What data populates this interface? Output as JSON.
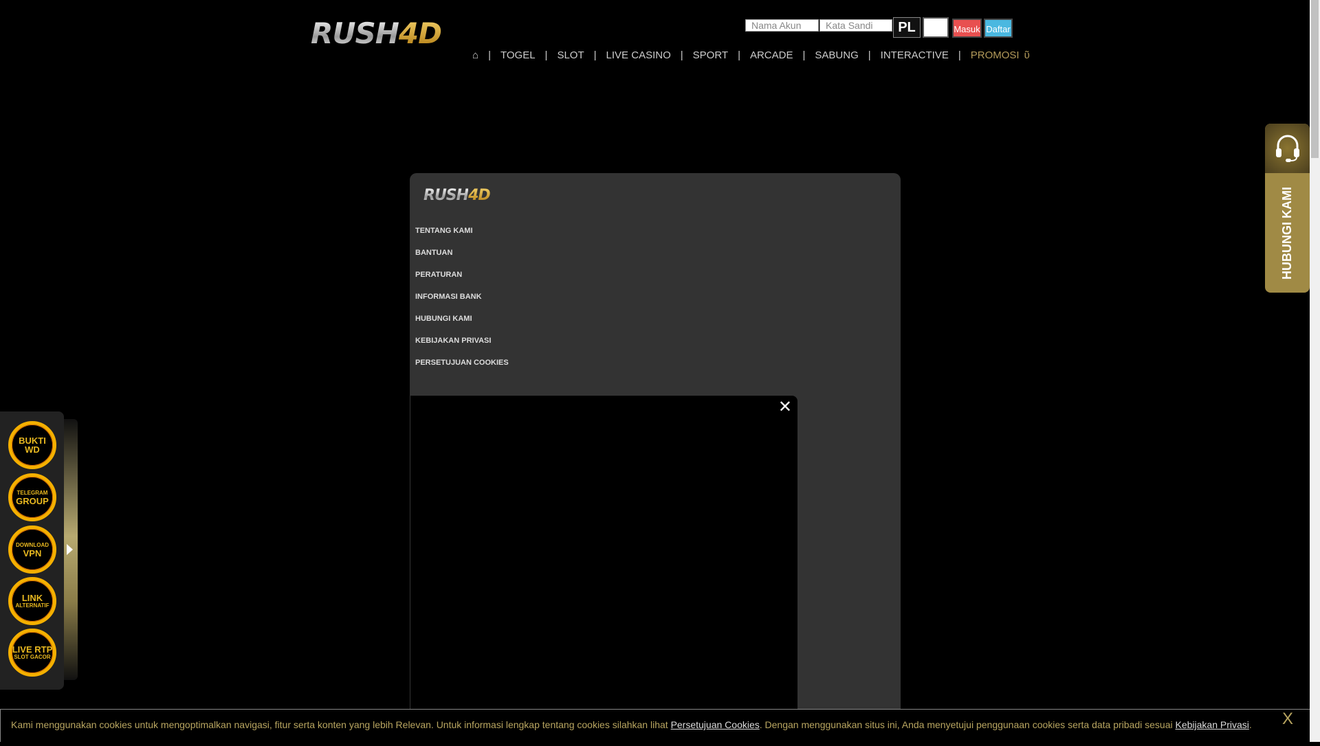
{
  "brand": {
    "logo_a": "RUSH",
    "logo_b": "4D"
  },
  "login": {
    "username_placeholder": "Nama Akun",
    "password_placeholder": "Kata Sandi",
    "captcha": "PL",
    "login_label": "Masuk",
    "register_label": "Daftar"
  },
  "colors": {
    "login": "#e85050",
    "register": "#4ab8e0",
    "gold": "#b39a5a"
  },
  "nav": {
    "home": "⌂",
    "items": [
      "TOGEL",
      "SLOT",
      "LIVE CASINO",
      "SPORT",
      "ARCADE",
      "SABUNG",
      "INTERACTIVE"
    ],
    "promo": "PROMOSI"
  },
  "footer_menu": [
    "TENTANG KAMI",
    "BANTUAN",
    "PERATURAN",
    "INFORMASI BANK",
    "HUBUNGI KAMI",
    "KEBIJAKAN PRIVASI",
    "PERSETUJUAN COOKIES"
  ],
  "side_buttons": [
    {
      "l1": "BUKTI",
      "l2": "WD"
    },
    {
      "l1": "TELEGRAM",
      "l2": "GROUP"
    },
    {
      "l1": "DOWNLOAD",
      "l2": "VPN"
    },
    {
      "l1": "LINK",
      "l2": "ALTERNATIF"
    },
    {
      "l1": "LIVE RTP",
      "l2": "SLOT GACOR"
    }
  ],
  "contact": {
    "label": "HUBUNGI KAMI"
  },
  "cookie": {
    "text1": "Kami menggunakan cookies untuk mengoptimalkan navigasi, fitur serta konten yang lebih Relevan. Untuk informasi lengkap tentang cookies silahkan lihat ",
    "link1": "Persetujuan Cookies",
    "text2": ". Dengan menggunakan situs ini, Anda menyetujui penggunaan cookies serta data pribadi sesuai ",
    "link2": "Kebijakan Privasi",
    "text3": ".",
    "close": "X"
  },
  "video": {
    "close": "✕"
  }
}
